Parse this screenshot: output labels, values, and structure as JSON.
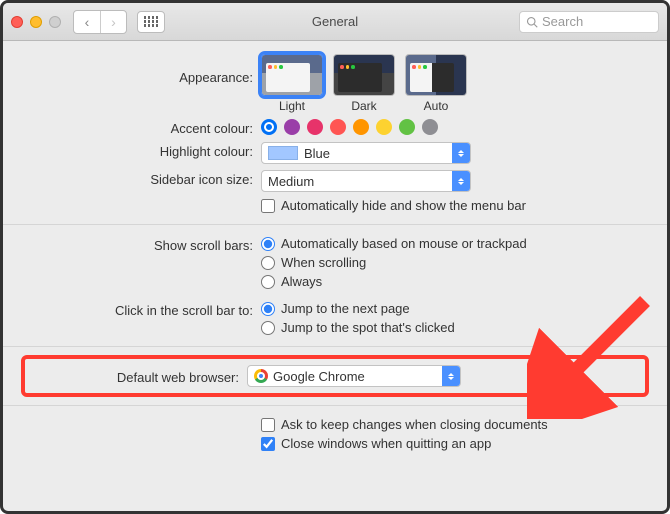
{
  "window": {
    "title": "General"
  },
  "search": {
    "placeholder": "Search"
  },
  "appearance": {
    "label": "Appearance:",
    "options": [
      "Light",
      "Dark",
      "Auto"
    ],
    "selected": "Light"
  },
  "accent": {
    "label": "Accent colour:",
    "colors": [
      "#0070f5",
      "#9a3ea8",
      "#e7336a",
      "#ff5553",
      "#ff9500",
      "#fdd230",
      "#62c244",
      "#8e8e93"
    ],
    "selected_index": 0
  },
  "highlight": {
    "label": "Highlight colour:",
    "value": "Blue"
  },
  "sidebar_size": {
    "label": "Sidebar icon size:",
    "value": "Medium"
  },
  "auto_hide_menu": {
    "label": "Automatically hide and show the menu bar",
    "checked": false
  },
  "scroll_bars": {
    "label": "Show scroll bars:",
    "options": [
      "Automatically based on mouse or trackpad",
      "When scrolling",
      "Always"
    ],
    "selected_index": 0
  },
  "click_scroll": {
    "label": "Click in the scroll bar to:",
    "options": [
      "Jump to the next page",
      "Jump to the spot that's clicked"
    ],
    "selected_index": 0
  },
  "default_browser": {
    "label": "Default web browser:",
    "value": "Google Chrome"
  },
  "ask_changes": {
    "label": "Ask to keep changes when closing documents",
    "checked": false
  },
  "close_windows": {
    "label": "Close windows when quitting an app",
    "checked": true
  }
}
